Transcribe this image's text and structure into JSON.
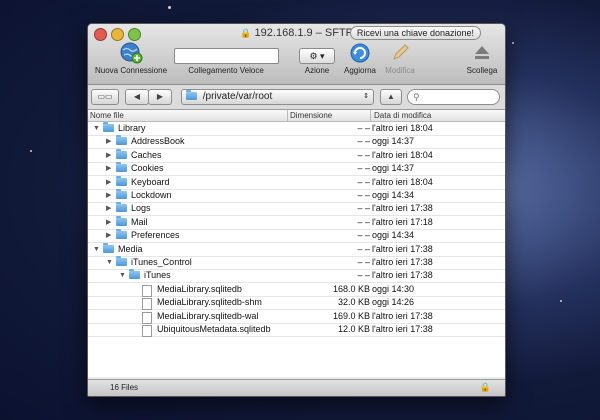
{
  "window": {
    "title": "192.168.1.9 – SFTP",
    "donate_label": "Ricevi una chiave donazione!"
  },
  "toolbar": {
    "new_connection": "Nuova Connessione",
    "quick_connect": "Collegamento Veloce",
    "action": "Azione",
    "refresh": "Aggiorna",
    "edit": "Modifica",
    "disconnect": "Scollega"
  },
  "navbar": {
    "path": "/private/var/root"
  },
  "columns": {
    "name": "Nome file",
    "size": "Dimensione",
    "date": "Data di modifica"
  },
  "files": [
    {
      "name": "Library",
      "size": "– –",
      "date": "l'altro ieri 18:04",
      "type": "folder",
      "depth": 0,
      "expanded": true
    },
    {
      "name": "AddressBook",
      "size": "– –",
      "date": "oggi 14:37",
      "type": "folder",
      "depth": 1,
      "expanded": false
    },
    {
      "name": "Caches",
      "size": "– –",
      "date": "l'altro ieri 18:04",
      "type": "folder",
      "depth": 1,
      "expanded": false
    },
    {
      "name": "Cookies",
      "size": "– –",
      "date": "oggi 14:37",
      "type": "folder",
      "depth": 1,
      "expanded": false
    },
    {
      "name": "Keyboard",
      "size": "– –",
      "date": "l'altro ieri 18:04",
      "type": "folder",
      "depth": 1,
      "expanded": false
    },
    {
      "name": "Lockdown",
      "size": "– –",
      "date": "oggi 14:34",
      "type": "folder",
      "depth": 1,
      "expanded": false
    },
    {
      "name": "Logs",
      "size": "– –",
      "date": "l'altro ieri 17:38",
      "type": "folder",
      "depth": 1,
      "expanded": false
    },
    {
      "name": "Mail",
      "size": "– –",
      "date": "l'altro ieri 17:18",
      "type": "folder",
      "depth": 1,
      "expanded": false
    },
    {
      "name": "Preferences",
      "size": "– –",
      "date": "oggi 14:34",
      "type": "folder",
      "depth": 1,
      "expanded": false
    },
    {
      "name": "Media",
      "size": "– –",
      "date": "l'altro ieri 17:38",
      "type": "folder",
      "depth": 0,
      "expanded": true
    },
    {
      "name": "iTunes_Control",
      "size": "– –",
      "date": "l'altro ieri 17:38",
      "type": "folder",
      "depth": 1,
      "expanded": true
    },
    {
      "name": "iTunes",
      "size": "– –",
      "date": "l'altro ieri 17:38",
      "type": "folder",
      "depth": 2,
      "expanded": true
    },
    {
      "name": "MediaLibrary.sqlitedb",
      "size": "168.0 KB",
      "date": "oggi 14:30",
      "type": "file",
      "depth": 3
    },
    {
      "name": "MediaLibrary.sqlitedb-shm",
      "size": "32.0 KB",
      "date": "oggi 14:26",
      "type": "file",
      "depth": 3
    },
    {
      "name": "MediaLibrary.sqlitedb-wal",
      "size": "169.0 KB",
      "date": "l'altro ieri 17:38",
      "type": "file",
      "depth": 3
    },
    {
      "name": "UbiquitousMetadata.sqlitedb",
      "size": "12.0 KB",
      "date": "l'altro ieri 17:38",
      "type": "file",
      "depth": 3
    }
  ],
  "status": {
    "count": "16 Files"
  }
}
